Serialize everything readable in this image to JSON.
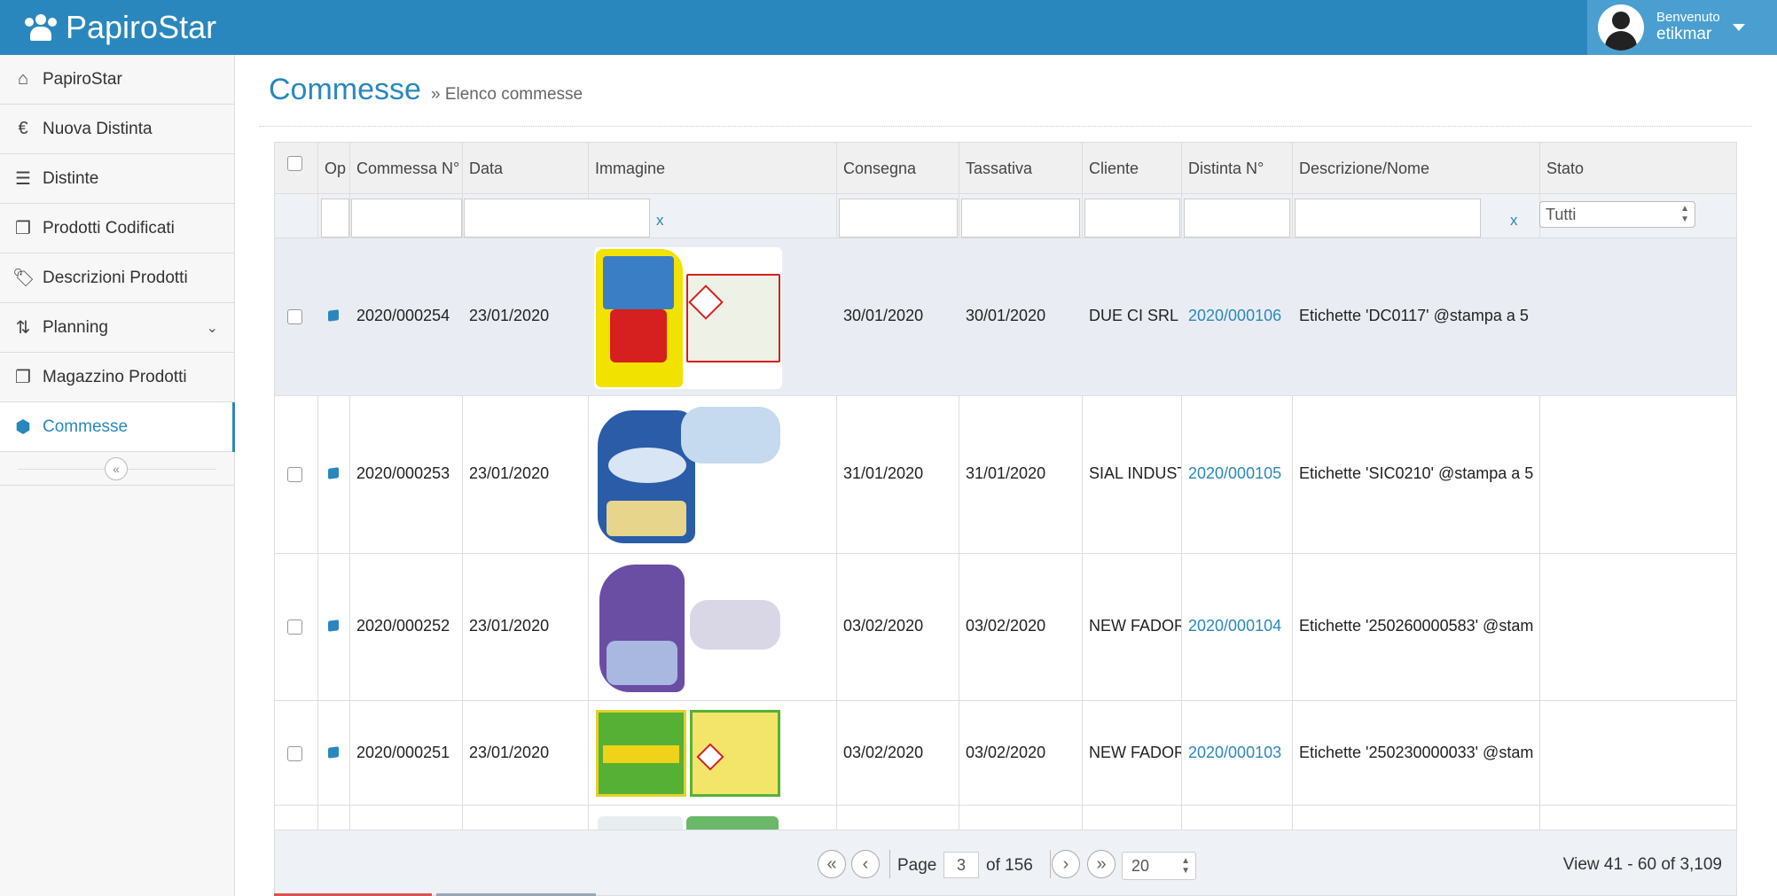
{
  "app": {
    "title": "PapiroStar"
  },
  "user": {
    "greeting": "Benvenuto",
    "name": "etikmar"
  },
  "sidebar": {
    "items": [
      {
        "label": "PapiroStar",
        "icon": "home-icon",
        "glyph": "⌂"
      },
      {
        "label": "Nuova Distinta",
        "icon": "euro-icon",
        "glyph": "€"
      },
      {
        "label": "Distinte",
        "icon": "server-icon",
        "glyph": "☰"
      },
      {
        "label": "Prodotti Codificati",
        "icon": "copy-icon",
        "glyph": "❐"
      },
      {
        "label": "Descrizioni Prodotti",
        "icon": "tags-icon",
        "glyph": "🏷"
      },
      {
        "label": "Planning",
        "icon": "sort-icon",
        "glyph": "⇅"
      },
      {
        "label": "Magazzino Prodotti",
        "icon": "copy-icon",
        "glyph": "❐"
      },
      {
        "label": "Commesse",
        "icon": "cube-icon",
        "glyph": "⬢"
      }
    ],
    "collapse_glyph": "«"
  },
  "page": {
    "title": "Commesse",
    "breadcrumb": "» Elenco commesse"
  },
  "grid": {
    "columns": [
      "Op",
      "Commessa N°",
      "Data",
      "Immagine",
      "Consegna",
      "Tassativa",
      "Cliente",
      "Distinta N°",
      "Descrizione/Nome",
      "Stato"
    ],
    "filter": {
      "clear_label": "x",
      "stato_value": "Tutti"
    },
    "rows": [
      {
        "commessa": "2020/000254",
        "data": "23/01/2020",
        "consegna": "30/01/2020",
        "tassativa": "30/01/2020",
        "cliente": "DUE CI SRL",
        "distinta": "2020/000106",
        "descrizione": "Etichette 'DC0117' @stampa a 5"
      },
      {
        "commessa": "2020/000253",
        "data": "23/01/2020",
        "consegna": "31/01/2020",
        "tassativa": "31/01/2020",
        "cliente": "SIAL INDUST",
        "distinta": "2020/000105",
        "descrizione": "Etichette 'SIC0210' @stampa a 5"
      },
      {
        "commessa": "2020/000252",
        "data": "23/01/2020",
        "consegna": "03/02/2020",
        "tassativa": "03/02/2020",
        "cliente": "NEW FADOR",
        "distinta": "2020/000104",
        "descrizione": "Etichette '250260000583' @stam"
      },
      {
        "commessa": "2020/000251",
        "data": "23/01/2020",
        "consegna": "03/02/2020",
        "tassativa": "03/02/2020",
        "cliente": "NEW FADOR",
        "distinta": "2020/000103",
        "descrizione": "Etichette '250230000033' @stam"
      }
    ]
  },
  "pager": {
    "page_label": "Page",
    "current_page": "3",
    "of_label": "of 156",
    "page_size": "20",
    "view_info": "View 41 - 60 of 3,109",
    "first": "«",
    "prev": "‹",
    "next": "›",
    "last": "»"
  },
  "colors": {
    "primary": "#2a87bd",
    "topbar": "#2a87bd",
    "userbox": "#4b9fd0"
  }
}
